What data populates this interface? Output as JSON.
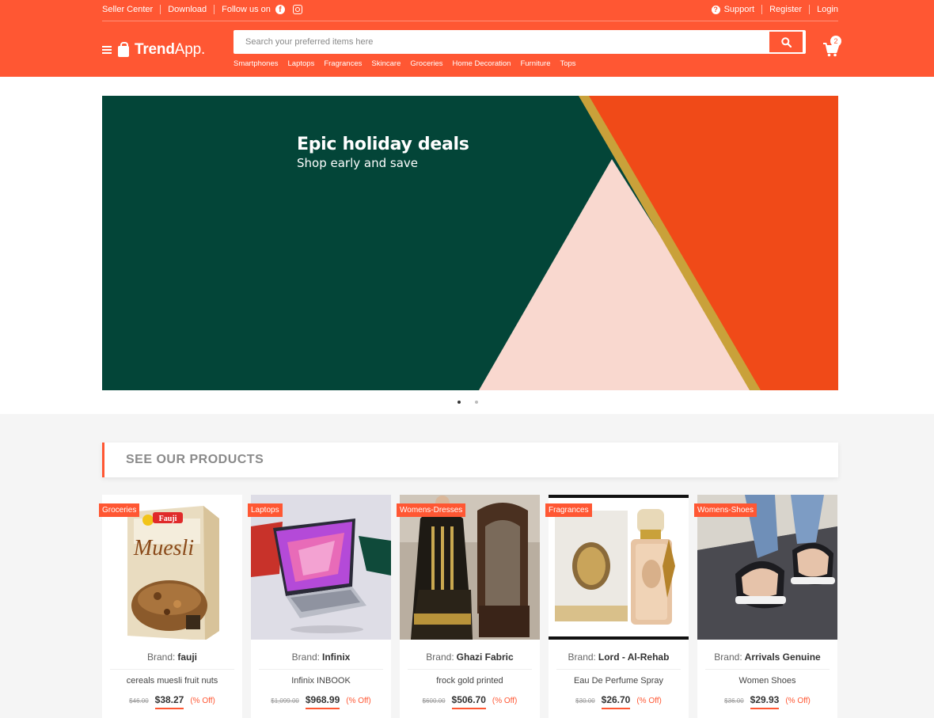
{
  "topbar": {
    "seller_center": "Seller Center",
    "download": "Download",
    "follow_us": "Follow us on",
    "support": "Support",
    "register": "Register",
    "login": "Login"
  },
  "logo": {
    "brand_bold": "Trend",
    "brand_rest": "App."
  },
  "search": {
    "placeholder": "Search your preferred items here"
  },
  "categories": [
    "Smartphones",
    "Laptops",
    "Fragrances",
    "Skincare",
    "Groceries",
    "Home Decoration",
    "Furniture",
    "Tops"
  ],
  "cart": {
    "count": "2"
  },
  "banner": {
    "title": "Epic holiday deals",
    "subtitle": "Shop early and save",
    "slide_count": 2,
    "active_slide": 1
  },
  "section": {
    "title": "SEE OUR PRODUCTS"
  },
  "products": [
    {
      "category": "Groceries",
      "brand_label": "Brand:",
      "brand": "fauji",
      "name": "cereals muesli fruit nuts",
      "old_price": "$46.00",
      "price": "$38.27",
      "off": "(% Off)"
    },
    {
      "category": "Laptops",
      "brand_label": "Brand:",
      "brand": "Infinix",
      "name": "Infinix INBOOK",
      "old_price": "$1,099.00",
      "price": "$968.99",
      "off": "(% Off)"
    },
    {
      "category": "Womens-Dresses",
      "brand_label": "Brand:",
      "brand": "Ghazi Fabric",
      "name": "frock gold printed",
      "old_price": "$600.00",
      "price": "$506.70",
      "off": "(% Off)"
    },
    {
      "category": "Fragrances",
      "brand_label": "Brand:",
      "brand": "Lord - Al-Rehab",
      "name": "Eau De Perfume Spray",
      "old_price": "$30.00",
      "price": "$26.70",
      "off": "(% Off)"
    },
    {
      "category": "Womens-Shoes",
      "brand_label": "Brand:",
      "brand": "Arrivals Genuine",
      "name": "Women Shoes",
      "old_price": "$36.00",
      "price": "$29.93",
      "off": "(% Off)"
    }
  ],
  "colors": {
    "accent": "#ff5733",
    "banner_green": "#034538",
    "banner_orange": "#f04a18",
    "banner_pink": "#f9d8cf",
    "gold": "#c9a13a"
  }
}
